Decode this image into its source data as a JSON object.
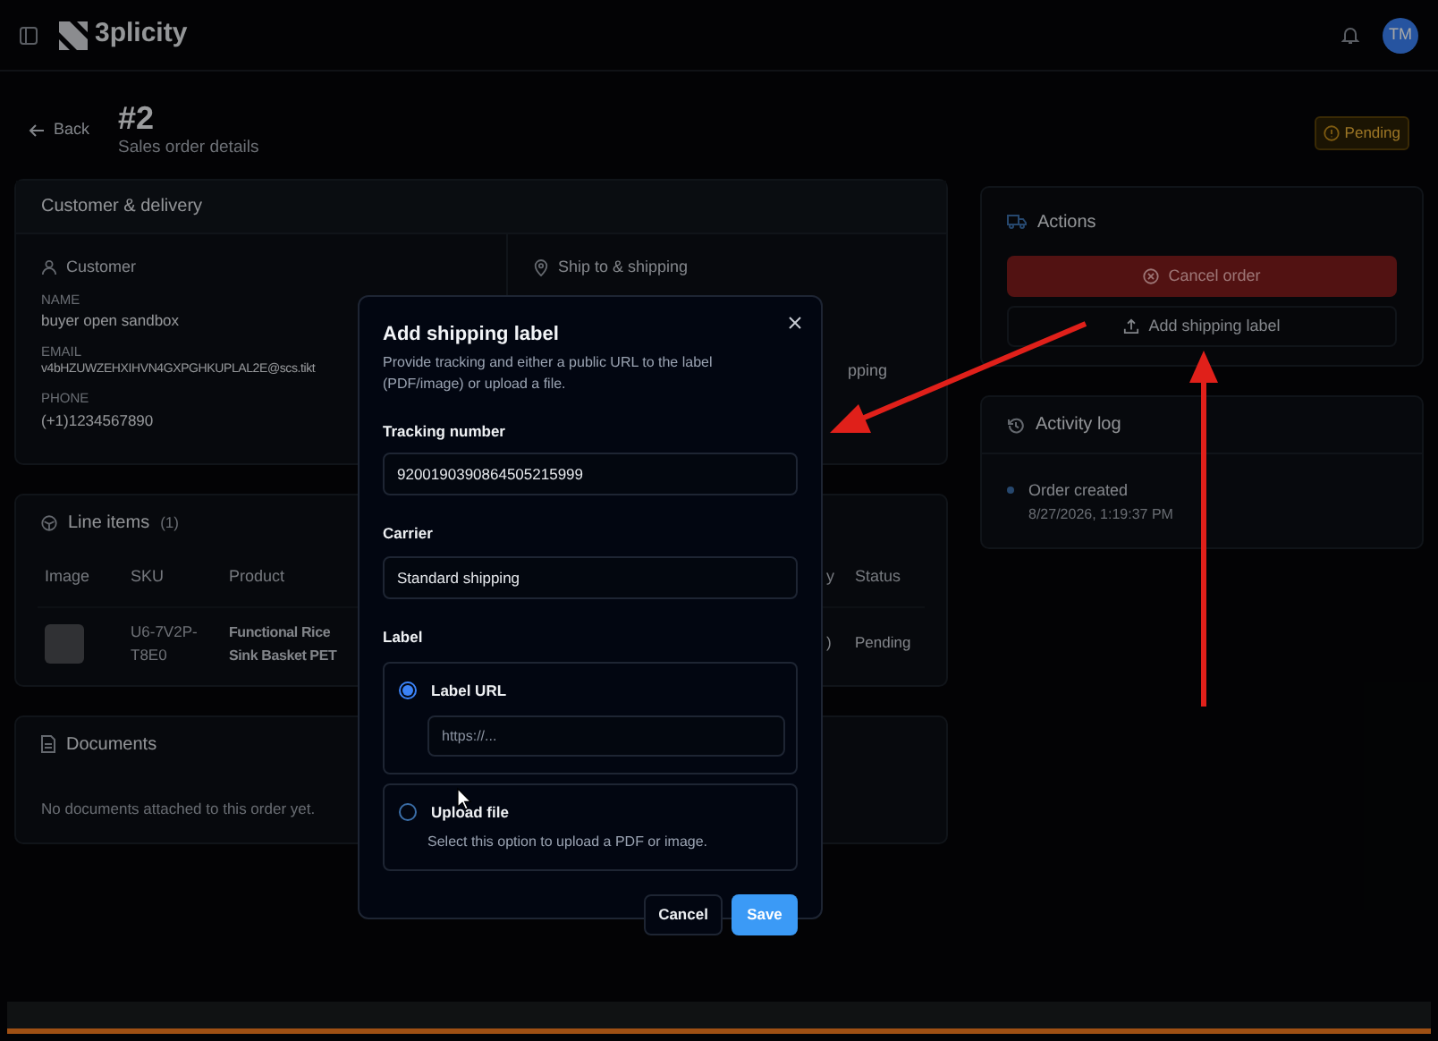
{
  "top_bar": {
    "brand": "3plicity",
    "avatar": "TM"
  },
  "header": {
    "back": "Back",
    "title": "#2",
    "subtitle": "Sales order details",
    "status": "Pending"
  },
  "customer_delivery": {
    "title": "Customer & delivery",
    "customer": {
      "heading": "Customer",
      "fields": [
        {
          "label": "NAME",
          "value": "buyer open sandbox"
        },
        {
          "label": "EMAIL",
          "value": "v4bHZUWZEHXIHVN4GXPGHKUPLAL2E@scs.tikt"
        },
        {
          "label": "PHONE",
          "value": "(+1)1234567890"
        }
      ]
    },
    "ship_to": {
      "heading": "Ship to & shipping",
      "text": "pping"
    }
  },
  "line_items": {
    "title": "Line items",
    "count": "(1)",
    "columns": [
      "Image",
      "SKU",
      "Product",
      "y",
      "Status"
    ],
    "rows": [
      {
        "sku": [
          "U6-7V2P-",
          "T8E0"
        ],
        "product": [
          "Functional Rice",
          "Sink Basket PET"
        ],
        "column_4": ")",
        "status": "Pending"
      }
    ]
  },
  "documents": {
    "title": "Documents",
    "empty": "No documents attached to this order yet."
  },
  "actions": {
    "title": "Actions",
    "buttons": [
      {
        "label": "Cancel order",
        "kind": "danger"
      },
      {
        "label": "Add shipping label",
        "kind": "outline"
      }
    ]
  },
  "activity_log": {
    "title": "Activity log",
    "entries": [
      {
        "title": "Order created",
        "time": "8/27/2026, 1:19:37 PM"
      }
    ]
  },
  "dialog": {
    "title": "Add shipping label",
    "description": "Provide tracking and either a public URL to the label (PDF/image) or upload a file.",
    "fields": [
      {
        "label": "Tracking number",
        "value": "9200190390864505215999"
      },
      {
        "label": "Carrier",
        "value": "Standard shipping"
      }
    ],
    "label_heading": "Label",
    "options": [
      {
        "label": "Label URL",
        "selected": true,
        "placeholder": "https://..."
      },
      {
        "label": "Upload file",
        "selected": false,
        "description": "Select this option to upload a PDF or image."
      }
    ],
    "buttons": [
      {
        "label": "Cancel",
        "kind": "secondary"
      },
      {
        "label": "Save",
        "kind": "primary"
      }
    ]
  }
}
